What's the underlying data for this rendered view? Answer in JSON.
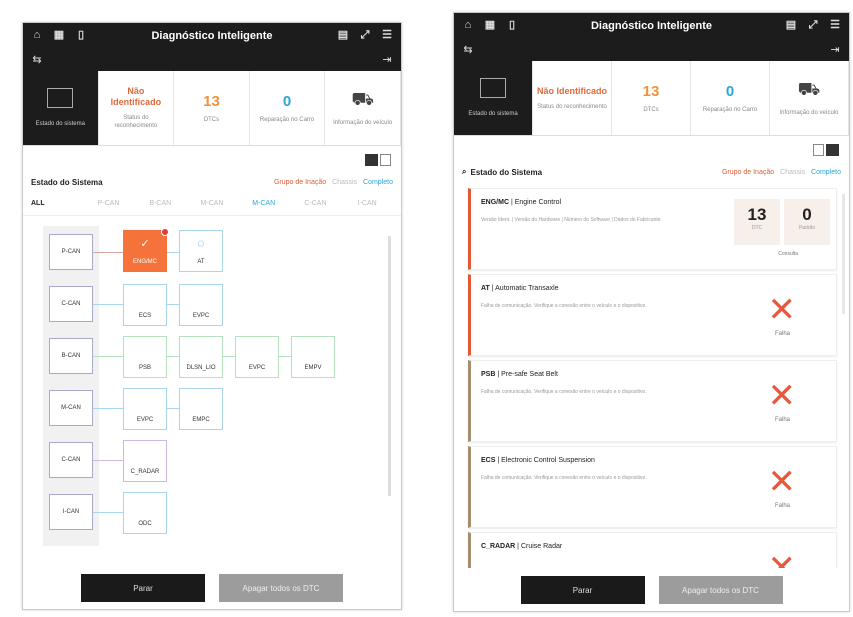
{
  "left": {
    "title": "Diagnóstico Inteligente",
    "stats": [
      {
        "label": "Estado do sistema"
      },
      {
        "value": "Não Identificado",
        "label": "Status do reconhecimento"
      },
      {
        "value": "13",
        "label": "DTCs"
      },
      {
        "value": "0",
        "label": "Reparação no Carro"
      },
      {
        "label": "Informação do veículo"
      }
    ],
    "section_title": "Estado do Sistema",
    "filters": [
      "Grupo de Inação",
      "Chassis",
      "Completo"
    ],
    "tabs": [
      "ALL",
      "P-CAN",
      "B-CAN",
      "M-CAN",
      "M-CAN",
      "C-CAN",
      "I-CAN"
    ],
    "buses": [
      "P-CAN",
      "C-CAN",
      "B-CAN",
      "M-CAN",
      "C-CAN",
      "I-CAN"
    ],
    "ecus": {
      "row1": [
        "ENG/MC",
        "AT"
      ],
      "row2": [
        "ECS",
        "EVPC"
      ],
      "row3": [
        "PSB",
        "DLSN_LIO",
        "EVPC",
        "EMPV"
      ],
      "row4": [
        "EVPC",
        "EMPC"
      ],
      "row5": [
        "C_RADAR"
      ],
      "row6": [
        "ODC"
      ]
    },
    "buttons": {
      "stop": "Parar",
      "clear": "Apagar todos os DTC"
    }
  },
  "right": {
    "title": "Diagnóstico Inteligente",
    "stats": [
      {
        "label": "Estado do sistema"
      },
      {
        "value": "Não Identificado",
        "label": "Status do reconhecimento"
      },
      {
        "value": "13",
        "label": "DTCs"
      },
      {
        "value": "0",
        "label": "Reparação no Carro"
      },
      {
        "label": "Informação do veículo"
      }
    ],
    "section_title": "Estado do Sistema",
    "filters": [
      "Grupo de Inação",
      "Chassis",
      "Completo"
    ],
    "items": [
      {
        "code": "ENG/MC",
        "name": "Engine Control",
        "desc": "Versão Ident. | Versão do Hardware | Número do Software | Dados do Fabricante",
        "counts": [
          {
            "n": "13",
            "l": "DTC"
          },
          {
            "n": "0",
            "l": "Padrão"
          }
        ],
        "counts_label": "Consulta"
      },
      {
        "code": "AT",
        "name": "Automatic Transaxle",
        "desc": "Falha de comunicação. Verifique a conexão entre o veículo e o dispositivo.",
        "status": "Falha"
      },
      {
        "code": "PSB",
        "name": "Pre-safe Seat Belt",
        "desc": "Falha de comunicação. Verifique a conexão entre o veículo e o dispositivo.",
        "status": "Falha"
      },
      {
        "code": "ECS",
        "name": "Electronic Control Suspension",
        "desc": "Falha de comunicação. Verifique a conexão entre o veículo e o dispositivo.",
        "status": "Falha"
      },
      {
        "code": "C_RADAR",
        "name": "Cruise Radar",
        "desc": "",
        "status": ""
      }
    ],
    "buttons": {
      "stop": "Parar",
      "clear": "Apagar todos os DTC"
    }
  },
  "colors": {
    "accent": "#f5733a",
    "error": "#e8583b",
    "blue": "#2aa7d8",
    "dark": "#1c1c1c"
  }
}
